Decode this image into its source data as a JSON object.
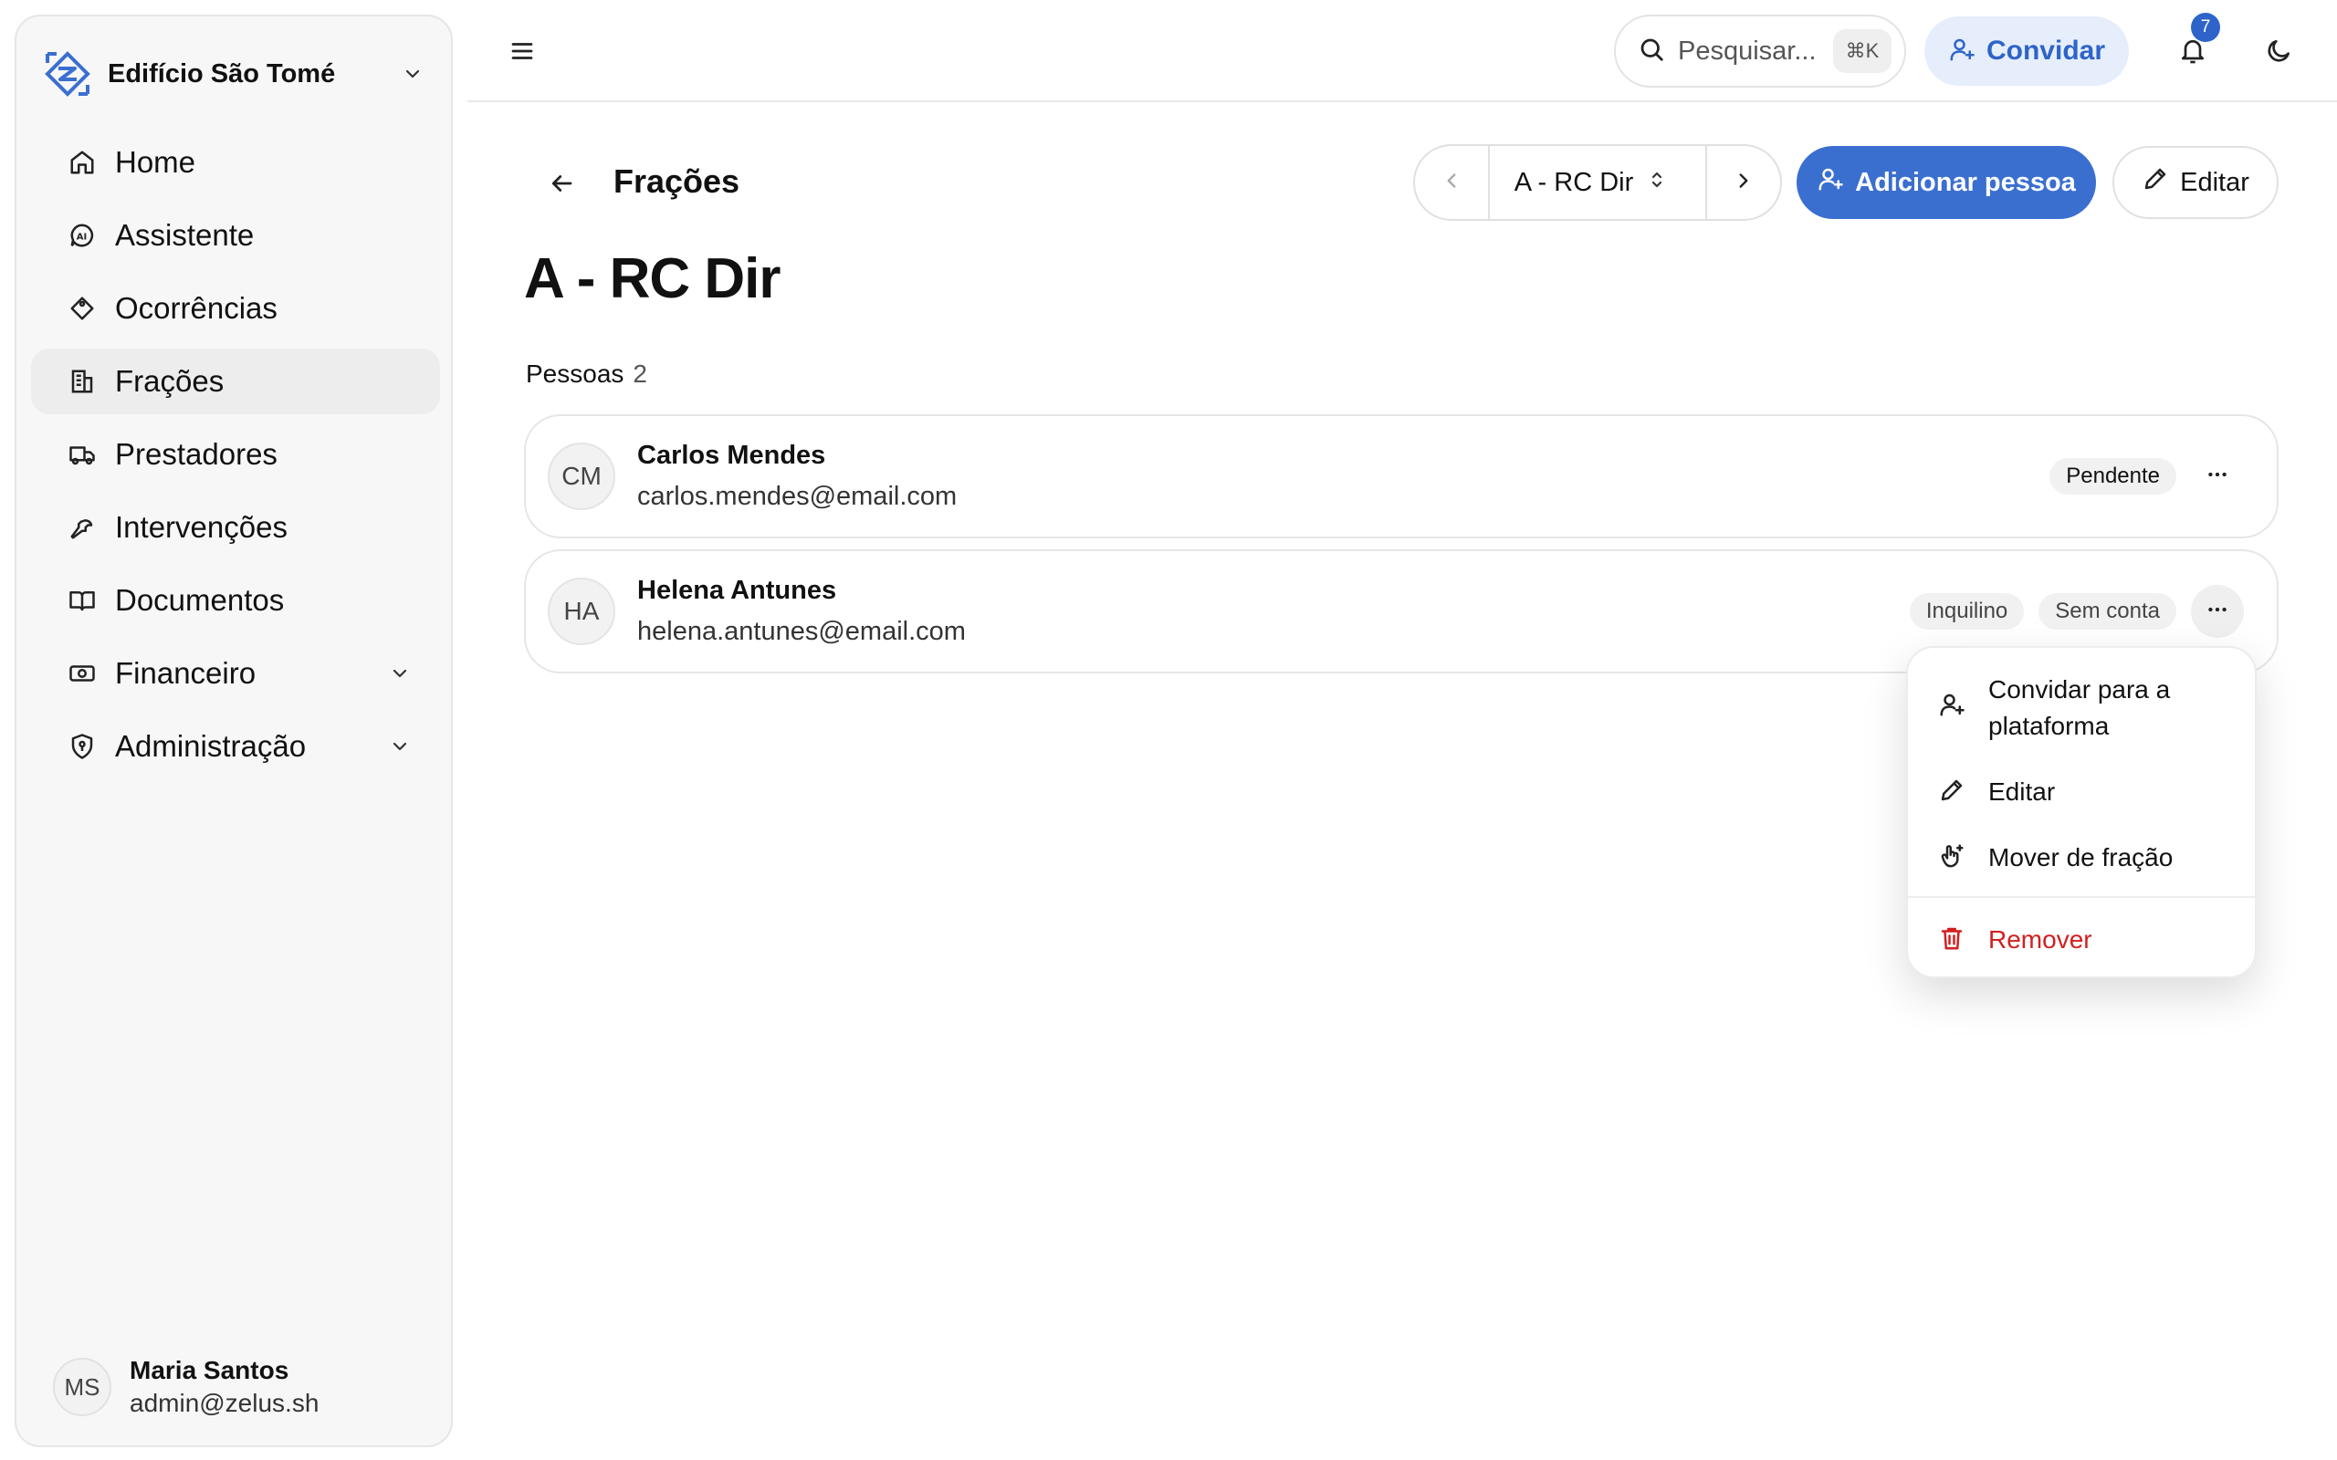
{
  "sidebar": {
    "org_name": "Edifício São Tomé",
    "items": [
      {
        "label": "Home",
        "icon": "home-icon"
      },
      {
        "label": "Assistente",
        "icon": "ai-assistant-icon"
      },
      {
        "label": "Ocorrências",
        "icon": "tag-icon"
      },
      {
        "label": "Frações",
        "icon": "building-icon"
      },
      {
        "label": "Prestadores",
        "icon": "truck-icon"
      },
      {
        "label": "Intervenções",
        "icon": "wrench-icon"
      },
      {
        "label": "Documentos",
        "icon": "book-icon"
      },
      {
        "label": "Financeiro",
        "icon": "money-icon"
      },
      {
        "label": "Administração",
        "icon": "shield-icon"
      }
    ],
    "user": {
      "initials": "MS",
      "name": "Maria Santos",
      "email": "admin@zelus.sh"
    }
  },
  "topbar": {
    "search_placeholder": "Pesquisar...",
    "search_shortcut": "⌘K",
    "invite_label": "Convidar",
    "notification_count": "7"
  },
  "header": {
    "title": "Frações",
    "selector_value": "A - RC Dir",
    "add_person_label": "Adicionar pessoa",
    "edit_label": "Editar"
  },
  "fraction": {
    "title": "A - RC Dir",
    "people_label": "Pessoas",
    "people_count": "2",
    "people": [
      {
        "initials": "CM",
        "name": "Carlos Mendes",
        "email": "carlos.mendes@email.com",
        "tags": [
          "Pendente"
        ]
      },
      {
        "initials": "HA",
        "name": "Helena Antunes",
        "email": "helena.antunes@email.com",
        "tags": [
          "Inquilino",
          "Sem conta"
        ]
      }
    ]
  },
  "menu": {
    "items": [
      {
        "label": "Convidar para a plataforma",
        "icon": "user-plus-icon"
      },
      {
        "label": "Editar",
        "icon": "pencil-icon"
      },
      {
        "label": "Mover de fração",
        "icon": "hand-move-icon"
      },
      {
        "label": "Remover",
        "icon": "trash-icon"
      }
    ]
  },
  "colors": {
    "accent": "#3a6fd0",
    "danger": "#d21f1f"
  }
}
